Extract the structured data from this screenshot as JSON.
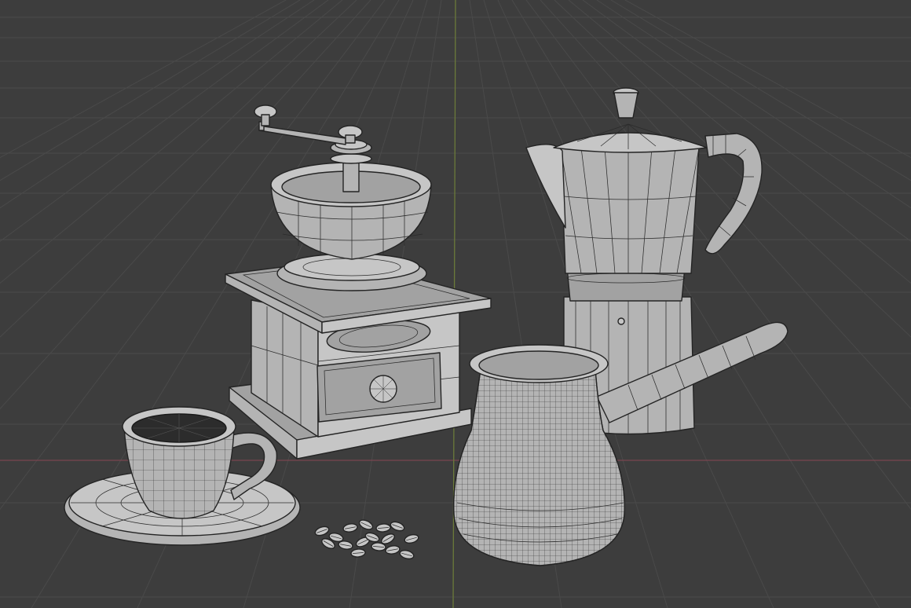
{
  "viewport": {
    "background_color": "#3d3d3d",
    "grid_color": "#4a4a4a",
    "x_axis_color": "#7a4650",
    "y_axis_color": "#6b7a3a",
    "mesh_color": "#b4b4b4",
    "wire_color": "#2b2b2b"
  },
  "objects": [
    "coffee-grinder",
    "moka-pot",
    "cezve",
    "coffee-cup",
    "saucer",
    "coffee-beans"
  ]
}
